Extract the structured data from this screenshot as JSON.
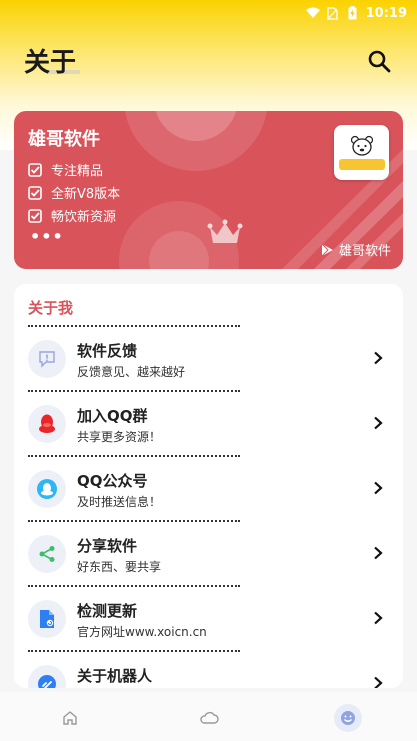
{
  "status_bar": {
    "time": "10:19"
  },
  "header": {
    "title": "关于"
  },
  "banner": {
    "title": "雄哥软件",
    "features": [
      "专注精品",
      "全新V8版本",
      "畅饮新资源"
    ],
    "more": "•••",
    "brand": "雄哥软件"
  },
  "about": {
    "title": "关于我",
    "items": [
      {
        "title": "软件反馈",
        "subtitle": "反馈意见、越来越好",
        "icon": "feedback-icon"
      },
      {
        "title": "加入QQ群",
        "subtitle": "共享更多资源！",
        "icon": "qq-penguin-icon"
      },
      {
        "title": "QQ公众号",
        "subtitle": "及时推送信息！",
        "icon": "qq-official-icon"
      },
      {
        "title": "分享软件",
        "subtitle": "好东西、要共享",
        "icon": "share-icon"
      },
      {
        "title": "检测更新",
        "subtitle": "官方网址www.xoicn.cn",
        "icon": "update-file-icon"
      },
      {
        "title": "关于机器人",
        "subtitle": "",
        "icon": "robot-link-icon"
      }
    ]
  },
  "bottom_nav": [
    "home-icon",
    "cloud-icon",
    "smiley-icon"
  ],
  "colors": {
    "accent": "#d9535b",
    "header_yellow": "#fbd200",
    "icon_blue": "#2d7ff2"
  }
}
